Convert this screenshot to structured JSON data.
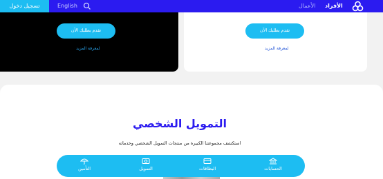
{
  "header": {
    "login_label": "تسجيل دخول",
    "language_label": "English",
    "nav_business": "الأعمال",
    "nav_individuals": "الأفراد"
  },
  "cards": {
    "dark": {
      "apply_label": "تقدم بطلبك الآن",
      "more_label": "لمعرفة المزيد"
    },
    "light": {
      "apply_label": "تقدم بطلبك الآن",
      "more_label": "لمعرفة المزيد"
    }
  },
  "section": {
    "title": "التمويل الشخصي",
    "subtitle": "استكشف مجموعتنا الكبيرة من منتجات التمويل الشخصي وخدماته"
  },
  "bottom_nav": {
    "items": [
      {
        "label": "التأمين",
        "icon": "umbrella-icon"
      },
      {
        "label": "التمويل",
        "icon": "finance-icon"
      },
      {
        "label": "البطاقات",
        "icon": "card-icon"
      },
      {
        "label": "الحسابات",
        "icon": "bank-icon"
      }
    ]
  },
  "colors": {
    "brand": "#2b1bf0",
    "accent": "#1dbdf2"
  }
}
